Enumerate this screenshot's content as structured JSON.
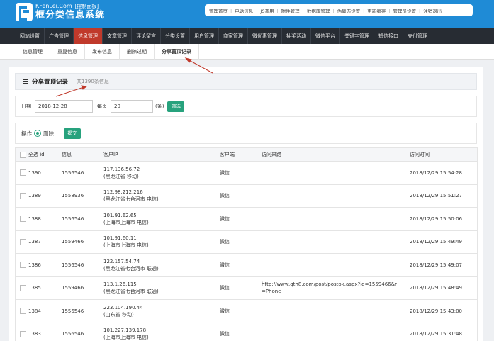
{
  "logo": {
    "brand": "KFenLei.Com",
    "control_panel": "[控制面板]",
    "title": "框分类信息系统"
  },
  "topbar": [
    "管理首页",
    "电话信息",
    "JS调用",
    "附件管理",
    "数据库管理",
    "伪静态设置",
    "更新缓存",
    "管理员设置",
    "注销退出"
  ],
  "mainnav": [
    "网站设置",
    "广告管理",
    "信息管理",
    "文章管理",
    "评论留言",
    "分类设置",
    "用户管理",
    "商家管理",
    "微优惠管理",
    "抽奖活动",
    "微信平台",
    "关键字管理",
    "短信接口",
    "支付管理"
  ],
  "mainnav_active": 2,
  "subnav": [
    "信息管理",
    "重复信息",
    "发布信息",
    "删除过期",
    "分享置顶记录"
  ],
  "subnav_active": 4,
  "panel": {
    "title": "分享置顶记录",
    "total": "共1390条信息"
  },
  "filter": {
    "date_label": "日期",
    "date_value": "2018-12-28",
    "per_page_label": "每页",
    "per_page_value": "20",
    "unit": "(条)",
    "button": "筛选"
  },
  "ops": {
    "label": "操作",
    "option": "删除",
    "button": "提交"
  },
  "table": {
    "headers": [
      "全选 id",
      "信息",
      "客户IP",
      "客户端",
      "访问来路",
      "访问时间"
    ],
    "rows": [
      {
        "id": "1390",
        "info": "1556546",
        "ip": "117.136.56.72",
        "loc": "(黑龙江省 移动)",
        "client": "微信",
        "ref": "",
        "time": "2018/12/29 15:54:28"
      },
      {
        "id": "1389",
        "info": "1558936",
        "ip": "112.98.212.216",
        "loc": "(黑龙江省七台河市 电信)",
        "client": "微信",
        "ref": "",
        "time": "2018/12/29 15:51:27"
      },
      {
        "id": "1388",
        "info": "1556546",
        "ip": "101.91.62.65",
        "loc": "(上海市上海市 电信)",
        "client": "微信",
        "ref": "",
        "time": "2018/12/29 15:50:06"
      },
      {
        "id": "1387",
        "info": "1559466",
        "ip": "101.91.60.11",
        "loc": "(上海市上海市 电信)",
        "client": "微信",
        "ref": "",
        "time": "2018/12/29 15:49:49"
      },
      {
        "id": "1386",
        "info": "1556546",
        "ip": "122.157.54.74",
        "loc": "(黑龙江省七台河市 联通)",
        "client": "微信",
        "ref": "",
        "time": "2018/12/29 15:49:07"
      },
      {
        "id": "1385",
        "info": "1559466",
        "ip": "113.1.26.115",
        "loc": "(黑龙江省七台河市 联通)",
        "client": "微信",
        "ref": "http://www.qth8.com/post/postok.aspx?id=1559466&r=Phone",
        "time": "2018/12/29 15:48:49"
      },
      {
        "id": "1384",
        "info": "1556546",
        "ip": "223.104.190.44",
        "loc": "(山东省 移动)",
        "client": "微信",
        "ref": "",
        "time": "2018/12/29 15:43:00"
      },
      {
        "id": "1383",
        "info": "1556546",
        "ip": "101.227.139.178",
        "loc": "(上海市上海市 电信)",
        "client": "微信",
        "ref": "",
        "time": "2018/12/29 15:31:48"
      }
    ]
  },
  "colors": {
    "header": "#1f8bd6",
    "nav": "#272c33",
    "active": "#c0392b",
    "accent": "#27a27d",
    "annotation": "#c0392b"
  }
}
